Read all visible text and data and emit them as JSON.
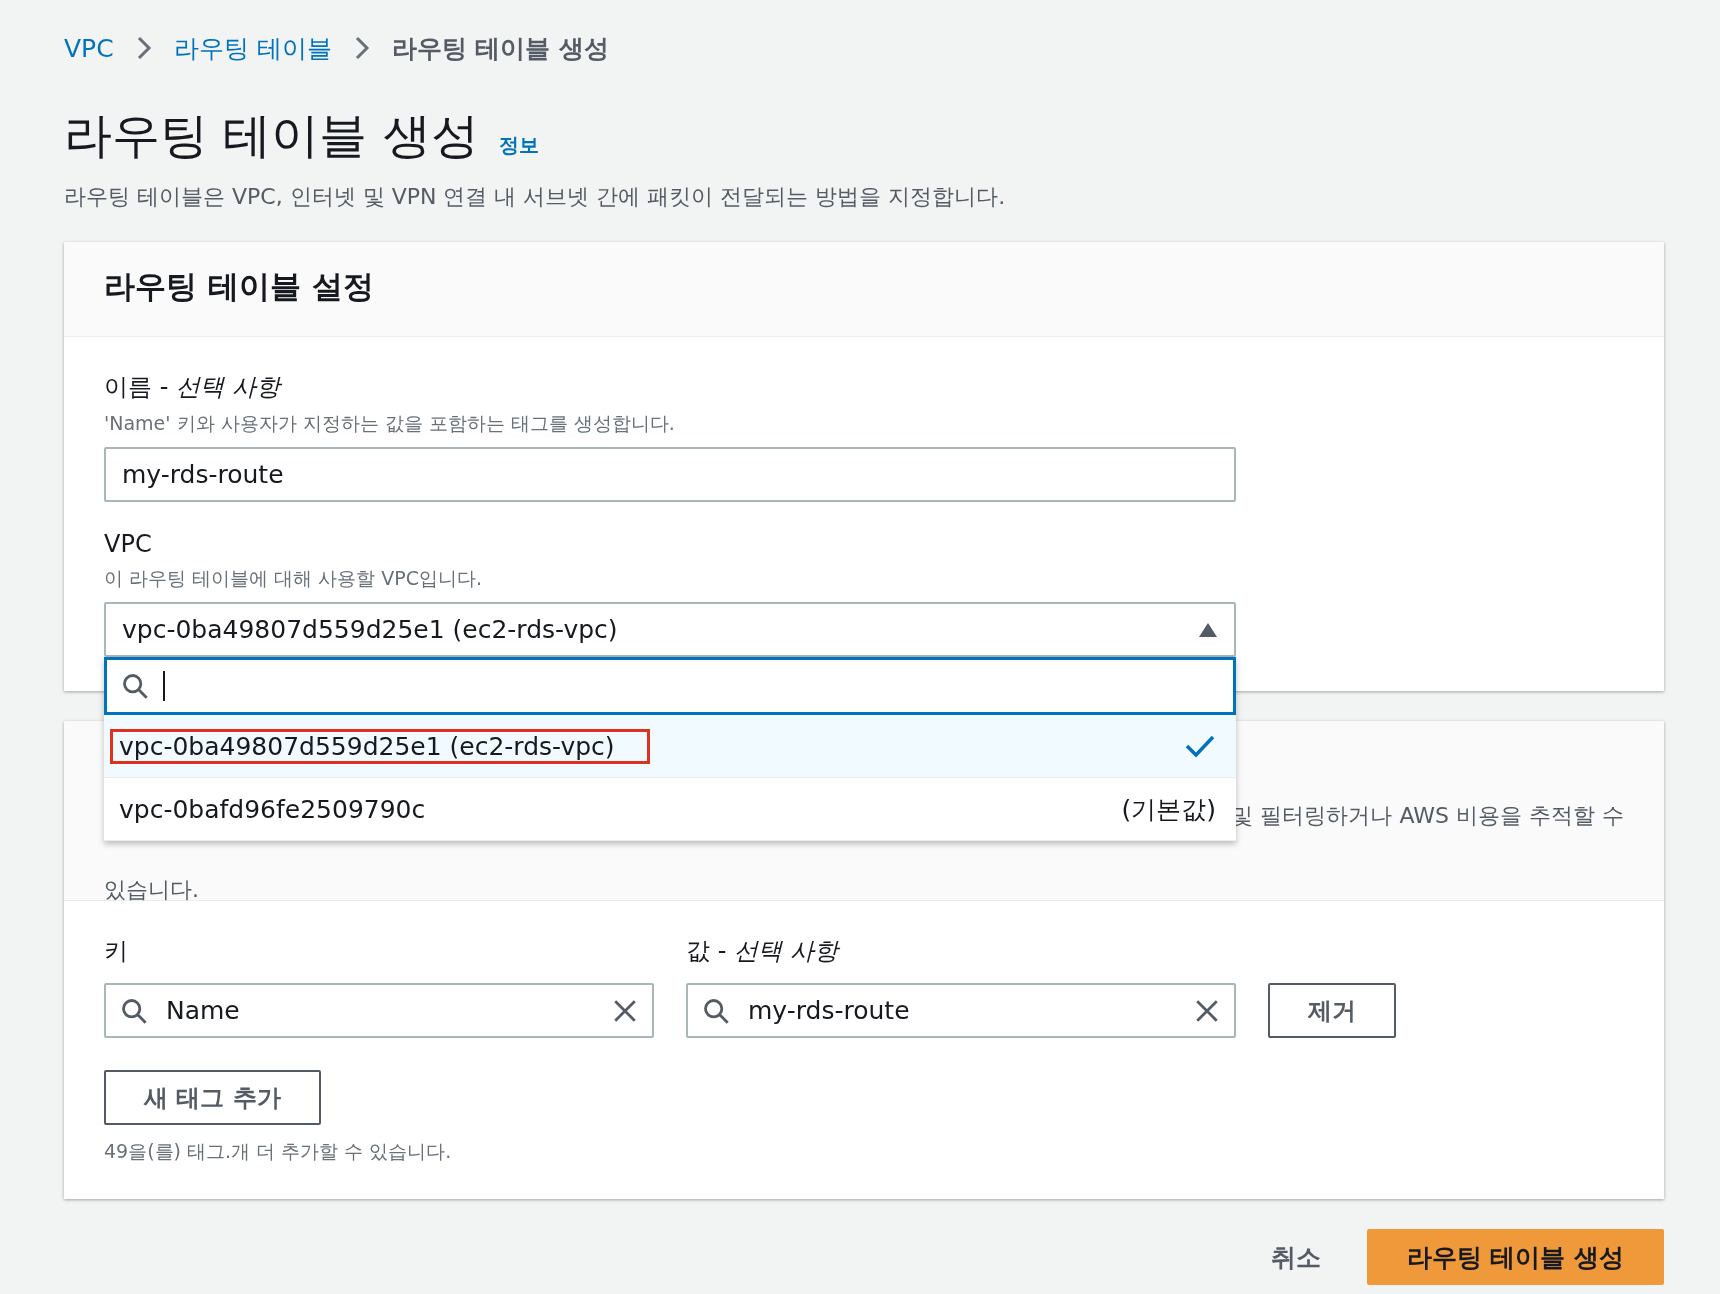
{
  "breadcrumb": [
    {
      "label": "VPC",
      "link": true
    },
    {
      "label": "라우팅 테이블",
      "link": true
    },
    {
      "label": "라우팅 테이블 생성",
      "link": false
    }
  ],
  "page": {
    "title": "라우팅 테이블 생성",
    "info": "정보",
    "description": "라우팅 테이블은 VPC, 인터넷 및 VPN 연결 내 서브넷 간에 패킷이 전달되는 방법을 지정합니다."
  },
  "settings": {
    "title": "라우팅 테이블 설정",
    "name_field": {
      "label": "이름 - ",
      "label_optional": "선택 사항",
      "hint": "'Name' 키와 사용자가 지정하는 값을 포함하는 태그를 생성합니다.",
      "value": "my-rds-route"
    },
    "vpc_field": {
      "label": "VPC",
      "hint": "이 라우팅 테이블에 대해 사용할 VPC입니다.",
      "value": "vpc-0ba49807d559d25e1 (ec2-rds-vpc)",
      "expanded": true,
      "options": [
        {
          "label": "vpc-0ba49807d559d25e1 (ec2-rds-vpc)",
          "selected": true,
          "highlighted": true
        },
        {
          "label": "vpc-0bafd96fe2509790c",
          "tag": "(기본값)",
          "selected": false,
          "highlighted": false
        }
      ]
    }
  },
  "tags": {
    "description_visible": "및 필터링하거나 AWS 비용을 추적할 수",
    "description_line2": "있습니다.",
    "key_label": "키",
    "value_label": "값 - ",
    "value_optional": "선택 사항",
    "rows": [
      {
        "key": "Name",
        "value": "my-rds-route",
        "remove": "제거"
      }
    ],
    "add_button": "새 태그 추가",
    "limit": "49을(를) 태그.개 더 추가할 수 있습니다."
  },
  "footer": {
    "cancel": "취소",
    "submit": "라우팅 테이블 생성"
  }
}
